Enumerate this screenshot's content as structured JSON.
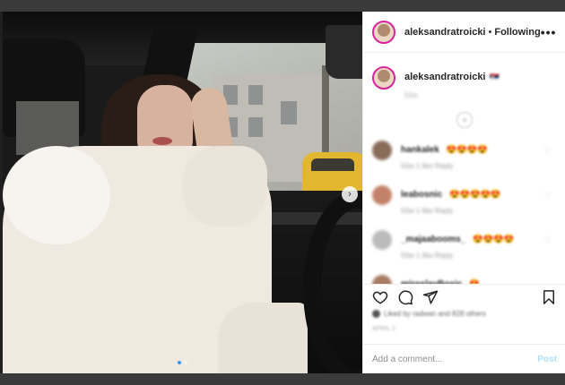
{
  "post": {
    "username": "aleksandratroicki",
    "separator": "•",
    "follow_status": "Following",
    "more_label": "•••"
  },
  "caption": {
    "username": "aleksandratroicki",
    "emoji": "🇷🇸",
    "time": "50w"
  },
  "load_more_label": "+",
  "comments": [
    {
      "user": "hankalek",
      "text": "😍😍😍😍",
      "meta": "50w  1 like  Reply"
    },
    {
      "user": "leabosnic",
      "text": "😍😍😍😍😍",
      "meta": "50w  1 like  Reply"
    },
    {
      "user": "_majaabooms_",
      "text": "😍😍😍😍",
      "meta": "50w  1 like  Reply"
    },
    {
      "user": "miroslavBosic",
      "text": "😍",
      "meta": ""
    }
  ],
  "likes": {
    "text": "Liked by radwan and 828 others"
  },
  "date": "APRIL 2",
  "add_comment": {
    "placeholder": "Add a comment...",
    "post_label": "Post"
  },
  "carousel": {
    "next_label": "›",
    "slide_count": 2,
    "active_index": 1
  },
  "colors": {
    "accent": "#3897f0",
    "post_disabled": "#b2dffc",
    "avatar_ring": "#d6249f"
  },
  "icons": [
    "heart-icon",
    "comment-icon",
    "share-icon",
    "bookmark-icon",
    "more-icon",
    "chevron-right-icon"
  ]
}
